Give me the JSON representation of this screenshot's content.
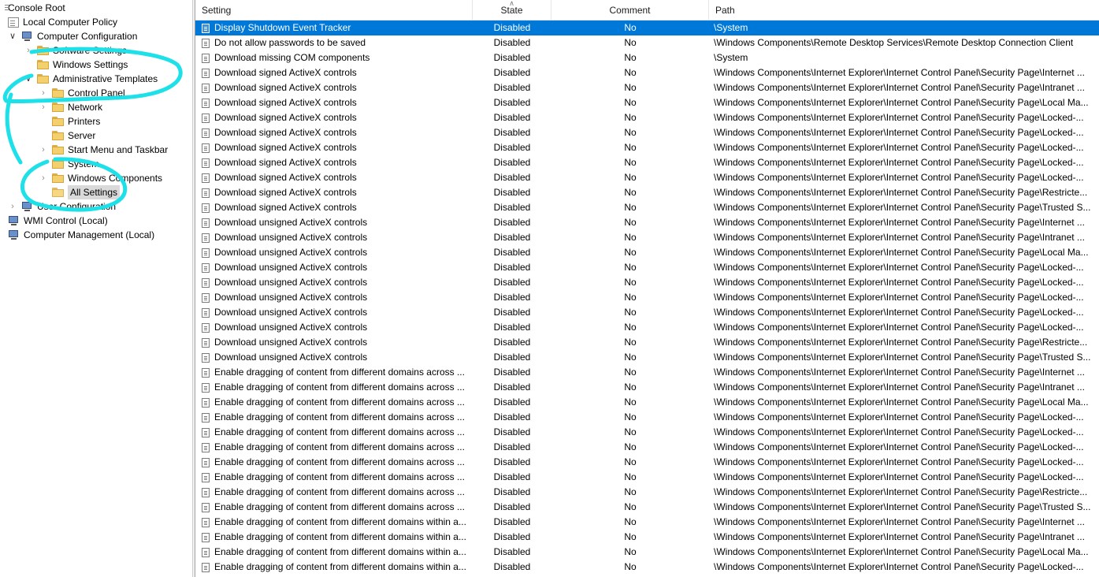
{
  "tree": {
    "console_root": "Console Root",
    "local_computer_policy": "Local Computer Policy",
    "computer_configuration": "Computer Configuration",
    "software_settings": "Software Settings",
    "windows_settings": "Windows Settings",
    "administrative_templates": "Administrative Templates",
    "control_panel": "Control Panel",
    "network": "Network",
    "printers": "Printers",
    "server": "Server",
    "start_menu": "Start Menu and Taskbar",
    "system": "System",
    "windows_components": "Windows Components",
    "all_settings": "All Settings",
    "user_configuration": "User Configuration",
    "wmi_control": "WMI Control (Local)",
    "computer_management": "Computer Management (Local)"
  },
  "list": {
    "columns": {
      "setting": "Setting",
      "state": "State",
      "comment": "Comment",
      "path": "Path"
    },
    "rows": [
      {
        "setting": "Display Shutdown Event Tracker",
        "state": "Disabled",
        "comment": "No",
        "path": "\\System"
      },
      {
        "setting": "Do not allow passwords to be saved",
        "state": "Disabled",
        "comment": "No",
        "path": "\\Windows Components\\Remote Desktop Services\\Remote Desktop Connection Client"
      },
      {
        "setting": "Download missing COM components",
        "state": "Disabled",
        "comment": "No",
        "path": "\\System"
      },
      {
        "setting": "Download signed ActiveX controls",
        "state": "Disabled",
        "comment": "No",
        "path": "\\Windows Components\\Internet Explorer\\Internet Control Panel\\Security Page\\Internet ..."
      },
      {
        "setting": "Download signed ActiveX controls",
        "state": "Disabled",
        "comment": "No",
        "path": "\\Windows Components\\Internet Explorer\\Internet Control Panel\\Security Page\\Intranet ..."
      },
      {
        "setting": "Download signed ActiveX controls",
        "state": "Disabled",
        "comment": "No",
        "path": "\\Windows Components\\Internet Explorer\\Internet Control Panel\\Security Page\\Local Ma..."
      },
      {
        "setting": "Download signed ActiveX controls",
        "state": "Disabled",
        "comment": "No",
        "path": "\\Windows Components\\Internet Explorer\\Internet Control Panel\\Security Page\\Locked-..."
      },
      {
        "setting": "Download signed ActiveX controls",
        "state": "Disabled",
        "comment": "No",
        "path": "\\Windows Components\\Internet Explorer\\Internet Control Panel\\Security Page\\Locked-..."
      },
      {
        "setting": "Download signed ActiveX controls",
        "state": "Disabled",
        "comment": "No",
        "path": "\\Windows Components\\Internet Explorer\\Internet Control Panel\\Security Page\\Locked-..."
      },
      {
        "setting": "Download signed ActiveX controls",
        "state": "Disabled",
        "comment": "No",
        "path": "\\Windows Components\\Internet Explorer\\Internet Control Panel\\Security Page\\Locked-..."
      },
      {
        "setting": "Download signed ActiveX controls",
        "state": "Disabled",
        "comment": "No",
        "path": "\\Windows Components\\Internet Explorer\\Internet Control Panel\\Security Page\\Locked-..."
      },
      {
        "setting": "Download signed ActiveX controls",
        "state": "Disabled",
        "comment": "No",
        "path": "\\Windows Components\\Internet Explorer\\Internet Control Panel\\Security Page\\Restricte..."
      },
      {
        "setting": "Download signed ActiveX controls",
        "state": "Disabled",
        "comment": "No",
        "path": "\\Windows Components\\Internet Explorer\\Internet Control Panel\\Security Page\\Trusted S..."
      },
      {
        "setting": "Download unsigned ActiveX controls",
        "state": "Disabled",
        "comment": "No",
        "path": "\\Windows Components\\Internet Explorer\\Internet Control Panel\\Security Page\\Internet ..."
      },
      {
        "setting": "Download unsigned ActiveX controls",
        "state": "Disabled",
        "comment": "No",
        "path": "\\Windows Components\\Internet Explorer\\Internet Control Panel\\Security Page\\Intranet ..."
      },
      {
        "setting": "Download unsigned ActiveX controls",
        "state": "Disabled",
        "comment": "No",
        "path": "\\Windows Components\\Internet Explorer\\Internet Control Panel\\Security Page\\Local Ma..."
      },
      {
        "setting": "Download unsigned ActiveX controls",
        "state": "Disabled",
        "comment": "No",
        "path": "\\Windows Components\\Internet Explorer\\Internet Control Panel\\Security Page\\Locked-..."
      },
      {
        "setting": "Download unsigned ActiveX controls",
        "state": "Disabled",
        "comment": "No",
        "path": "\\Windows Components\\Internet Explorer\\Internet Control Panel\\Security Page\\Locked-..."
      },
      {
        "setting": "Download unsigned ActiveX controls",
        "state": "Disabled",
        "comment": "No",
        "path": "\\Windows Components\\Internet Explorer\\Internet Control Panel\\Security Page\\Locked-..."
      },
      {
        "setting": "Download unsigned ActiveX controls",
        "state": "Disabled",
        "comment": "No",
        "path": "\\Windows Components\\Internet Explorer\\Internet Control Panel\\Security Page\\Locked-..."
      },
      {
        "setting": "Download unsigned ActiveX controls",
        "state": "Disabled",
        "comment": "No",
        "path": "\\Windows Components\\Internet Explorer\\Internet Control Panel\\Security Page\\Locked-..."
      },
      {
        "setting": "Download unsigned ActiveX controls",
        "state": "Disabled",
        "comment": "No",
        "path": "\\Windows Components\\Internet Explorer\\Internet Control Panel\\Security Page\\Restricte..."
      },
      {
        "setting": "Download unsigned ActiveX controls",
        "state": "Disabled",
        "comment": "No",
        "path": "\\Windows Components\\Internet Explorer\\Internet Control Panel\\Security Page\\Trusted S..."
      },
      {
        "setting": "Enable dragging of content from different domains across ...",
        "state": "Disabled",
        "comment": "No",
        "path": "\\Windows Components\\Internet Explorer\\Internet Control Panel\\Security Page\\Internet ..."
      },
      {
        "setting": "Enable dragging of content from different domains across ...",
        "state": "Disabled",
        "comment": "No",
        "path": "\\Windows Components\\Internet Explorer\\Internet Control Panel\\Security Page\\Intranet ..."
      },
      {
        "setting": "Enable dragging of content from different domains across ...",
        "state": "Disabled",
        "comment": "No",
        "path": "\\Windows Components\\Internet Explorer\\Internet Control Panel\\Security Page\\Local Ma..."
      },
      {
        "setting": "Enable dragging of content from different domains across ...",
        "state": "Disabled",
        "comment": "No",
        "path": "\\Windows Components\\Internet Explorer\\Internet Control Panel\\Security Page\\Locked-..."
      },
      {
        "setting": "Enable dragging of content from different domains across ...",
        "state": "Disabled",
        "comment": "No",
        "path": "\\Windows Components\\Internet Explorer\\Internet Control Panel\\Security Page\\Locked-..."
      },
      {
        "setting": "Enable dragging of content from different domains across ...",
        "state": "Disabled",
        "comment": "No",
        "path": "\\Windows Components\\Internet Explorer\\Internet Control Panel\\Security Page\\Locked-..."
      },
      {
        "setting": "Enable dragging of content from different domains across ...",
        "state": "Disabled",
        "comment": "No",
        "path": "\\Windows Components\\Internet Explorer\\Internet Control Panel\\Security Page\\Locked-..."
      },
      {
        "setting": "Enable dragging of content from different domains across ...",
        "state": "Disabled",
        "comment": "No",
        "path": "\\Windows Components\\Internet Explorer\\Internet Control Panel\\Security Page\\Locked-..."
      },
      {
        "setting": "Enable dragging of content from different domains across ...",
        "state": "Disabled",
        "comment": "No",
        "path": "\\Windows Components\\Internet Explorer\\Internet Control Panel\\Security Page\\Restricte..."
      },
      {
        "setting": "Enable dragging of content from different domains across ...",
        "state": "Disabled",
        "comment": "No",
        "path": "\\Windows Components\\Internet Explorer\\Internet Control Panel\\Security Page\\Trusted S..."
      },
      {
        "setting": "Enable dragging of content from different domains within a...",
        "state": "Disabled",
        "comment": "No",
        "path": "\\Windows Components\\Internet Explorer\\Internet Control Panel\\Security Page\\Internet ..."
      },
      {
        "setting": "Enable dragging of content from different domains within a...",
        "state": "Disabled",
        "comment": "No",
        "path": "\\Windows Components\\Internet Explorer\\Internet Control Panel\\Security Page\\Intranet ..."
      },
      {
        "setting": "Enable dragging of content from different domains within a...",
        "state": "Disabled",
        "comment": "No",
        "path": "\\Windows Components\\Internet Explorer\\Internet Control Panel\\Security Page\\Local Ma..."
      },
      {
        "setting": "Enable dragging of content from different domains within a...",
        "state": "Disabled",
        "comment": "No",
        "path": "\\Windows Components\\Internet Explorer\\Internet Control Panel\\Security Page\\Locked-..."
      }
    ]
  },
  "colors": {
    "selection": "#0078d7",
    "annotation": "#1ee0e8",
    "tree_selection": "#d9d9d9"
  }
}
